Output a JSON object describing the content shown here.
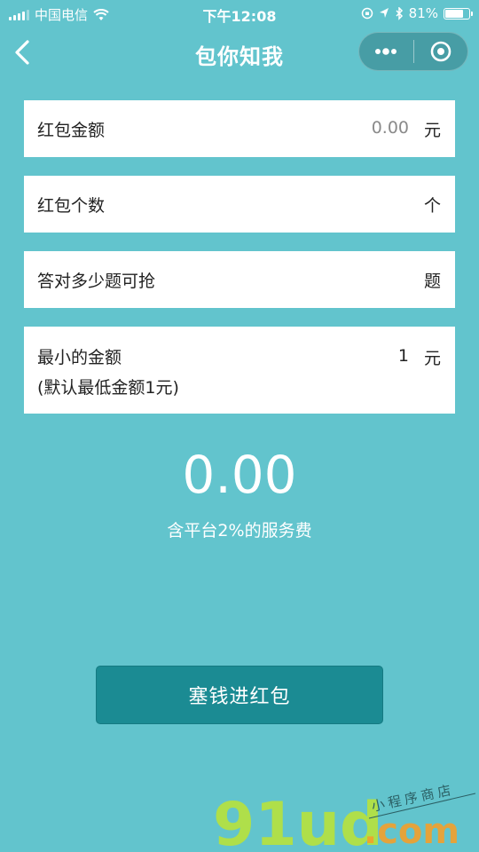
{
  "status_bar": {
    "carrier": "中国电信",
    "time": "下午12:08",
    "battery": "81%",
    "battery_level": 0.81,
    "signal_icon": "signal-icon",
    "wifi_icon": "wifi-icon"
  },
  "nav": {
    "title": "包你知我",
    "back_icon": "chevron-left-icon",
    "more_icon": "more-dots-icon",
    "close_icon": "target-circle-icon"
  },
  "form": {
    "amount": {
      "label": "红包金额",
      "placeholder": "0.00",
      "unit": "元"
    },
    "count": {
      "label": "红包个数",
      "placeholder": "",
      "unit": "个"
    },
    "answers": {
      "label": "答对多少题可抢",
      "placeholder": "",
      "unit": "题"
    },
    "min_amount": {
      "label": "最小的金额",
      "sub_label": "(默认最低金额1元)",
      "value": "1",
      "unit": "元"
    }
  },
  "summary": {
    "total": "0.00",
    "fee_note": "含平台2%的服务费"
  },
  "submit_label": "塞钱进红包",
  "watermark": {
    "brand": "91ud",
    "suffix": ".com",
    "tagline": "小程序商店"
  },
  "colors": {
    "background": "#62c4cd",
    "button": "#1b8b93",
    "watermark_green": "#b8e23c",
    "watermark_orange": "#f3a02c"
  }
}
